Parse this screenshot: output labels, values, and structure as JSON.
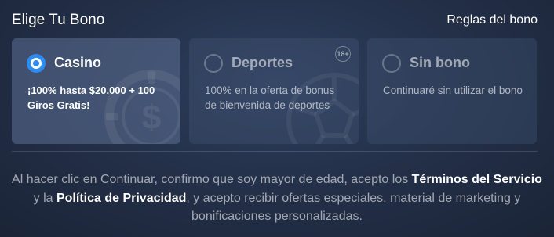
{
  "header": {
    "title": "Elige Tu Bono",
    "rules_link": "Reglas del bono"
  },
  "options": [
    {
      "id": "casino",
      "title": "Casino",
      "description": "¡100% hasta $20,000 + 100 Giros Gratis!",
      "selected": true,
      "icon": "casino-chip-icon"
    },
    {
      "id": "deportes",
      "title": "Deportes",
      "description": "100% en la oferta de bonus de bienvenida de deportes",
      "selected": false,
      "badge": "18+",
      "icon": "soccer-ball-icon"
    },
    {
      "id": "sin_bono",
      "title": "Sin bono",
      "description": "Continuaré sin utilizar el bono",
      "selected": false
    }
  ],
  "legal": {
    "part1": "Al hacer clic en Continuar, confirmo que soy mayor de edad, acepto los ",
    "terms_link": "Términos del Servicio",
    "part2": " y la ",
    "privacy_link": "Política de Privacidad",
    "part3": ", y acepto recibir ofertas especiales, material de marketing y bonificaciones personalizadas."
  },
  "colors": {
    "accent": "#2d8cf0",
    "background": "#24314a"
  }
}
